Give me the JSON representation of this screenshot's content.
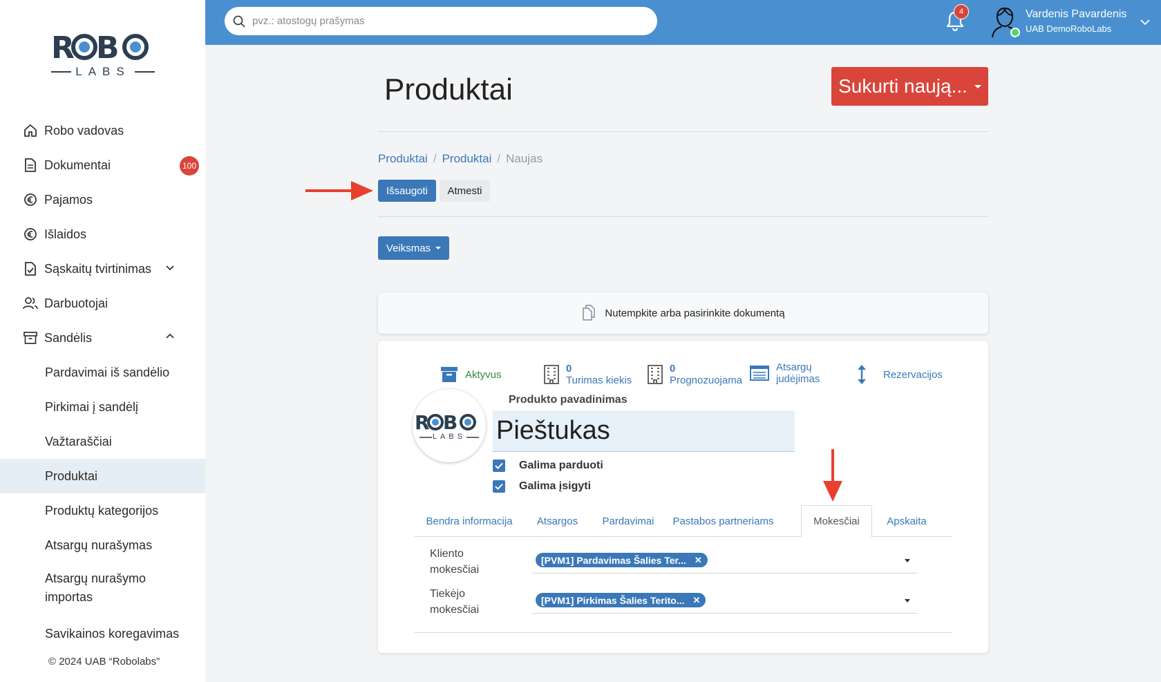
{
  "brand": {
    "logo_main": "ROBO",
    "logo_sub": "LABS"
  },
  "sidebar": {
    "items": [
      {
        "label": "Robo vadovas",
        "icon": "home-icon"
      },
      {
        "label": "Dokumentai",
        "icon": "document-icon",
        "badge": "100"
      },
      {
        "label": "Pajamos",
        "icon": "euro-icon"
      },
      {
        "label": "Išlaidos",
        "icon": "euro-icon"
      },
      {
        "label": "Sąskaitų tvirtinimas",
        "icon": "file-check-icon"
      },
      {
        "label": "Darbuotojai",
        "icon": "users-icon"
      },
      {
        "label": "Sandėlis",
        "icon": "archive-icon"
      }
    ],
    "sub_items": [
      {
        "label": "Pardavimai iš sandėlio"
      },
      {
        "label": "Pirkimai į sandėlį"
      },
      {
        "label": "Važtaraščiai"
      },
      {
        "label": "Produktai"
      },
      {
        "label": "Produktų kategorijos"
      },
      {
        "label": "Atsargų nurašymas"
      },
      {
        "label": "Atsargų nurašymo importas"
      },
      {
        "label": "Savikainos koregavimas"
      }
    ],
    "footer": "© 2024 UAB “Robolabs”"
  },
  "topbar": {
    "search_placeholder": "pvz.: atostogų prašymas",
    "notifications_count": "4",
    "user_name": "Vardenis Pavardenis",
    "user_company": "UAB DemoRoboLabs"
  },
  "page": {
    "title": "Produktai",
    "create_button": "Sukurti naują...",
    "breadcrumb": {
      "first": "Produktai",
      "second": "Produktai",
      "current": "Naujas"
    },
    "save_button": "Išsaugoti",
    "discard_button": "Atmesti",
    "action_button": "Veiksmas",
    "dropzone_text": "Nutempkite arba pasirinkite dokumentą"
  },
  "form": {
    "stats": {
      "active": "Aktyvus",
      "stock_qty": "0",
      "stock_label": "Turimas kiekis",
      "forecast_qty": "0",
      "forecast_label": "Prognozuojama",
      "moves_line1": "Atsargų",
      "moves_line2": "judėjimas",
      "reservations": "Rezervacijos"
    },
    "name_label": "Produkto pavadinimas",
    "name_value": "Pieštukas",
    "can_sell": "Galima parduoti",
    "can_buy": "Galima įsigyti",
    "tabs": [
      "Bendra informacija",
      "Atsargos",
      "Pardavimai",
      "Pastabos partneriams",
      "Mokesčiai",
      "Apskaita"
    ],
    "active_tab": "Mokesčiai",
    "customer_taxes_label_1": "Kliento",
    "customer_taxes_label_2": "mokesčiai",
    "customer_tax_chip": "[PVM1] Pardavimas Šalies Ter...",
    "vendor_taxes_label_1": "Tiekėjo",
    "vendor_taxes_label_2": "mokesčiai",
    "vendor_tax_chip": "[PVM1] Pirkimas Šalies Terito..."
  },
  "colors": {
    "topbar": "#4a90d0",
    "primary": "#3a78b8",
    "danger": "#d9453b",
    "active_green": "#2e8b3a"
  }
}
